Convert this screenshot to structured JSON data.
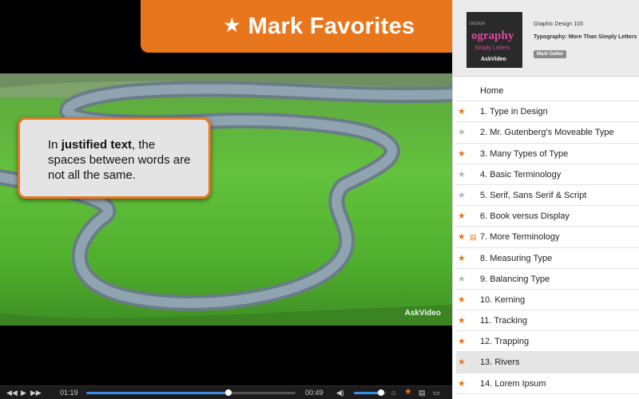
{
  "banner": {
    "star": "★",
    "title": "Mark Favorites"
  },
  "callout": {
    "prefix": "In ",
    "bold": "justified text",
    "rest": ", the spaces between words are not all the same."
  },
  "watermark": "AskVideo",
  "controls": {
    "elapsed": "01:19",
    "remaining": "00:49",
    "progress": 0.68,
    "volume": 0.85
  },
  "course": {
    "thumb_small": "DESIGN",
    "thumb_title": "ography",
    "thumb_sub": "Simply Letters",
    "thumb_brand": "AskVideo",
    "title": "Graphic Design 103",
    "subtitle": "Typography: More Than Simply Letters",
    "author": "Mark Gatter"
  },
  "chapters": [
    {
      "label": "Home",
      "star": "none",
      "doc": false,
      "selected": false
    },
    {
      "label": "1. Type in Design",
      "star": "on",
      "doc": false,
      "selected": false
    },
    {
      "label": "2. Mr. Gutenberg's Moveable Type",
      "star": "off",
      "doc": false,
      "selected": false
    },
    {
      "label": "3. Many Types of Type",
      "star": "on",
      "doc": false,
      "selected": false
    },
    {
      "label": "4. Basic Terminology",
      "star": "off",
      "doc": false,
      "selected": false
    },
    {
      "label": "5. Serif, Sans Serif & Script",
      "star": "off",
      "doc": false,
      "selected": false
    },
    {
      "label": "6. Book versus Display",
      "star": "on",
      "doc": false,
      "selected": false
    },
    {
      "label": "7. More Terminology",
      "star": "on",
      "doc": true,
      "selected": false
    },
    {
      "label": "8. Measuring Type",
      "star": "on",
      "doc": false,
      "selected": false
    },
    {
      "label": "9. Balancing Type",
      "star": "off",
      "doc": false,
      "selected": false
    },
    {
      "label": "10. Kerning",
      "star": "on",
      "doc": false,
      "selected": false
    },
    {
      "label": "11. Tracking",
      "star": "on",
      "doc": false,
      "selected": false
    },
    {
      "label": "12. Trapping",
      "star": "on",
      "doc": false,
      "selected": false
    },
    {
      "label": "13. Rivers",
      "star": "on",
      "doc": false,
      "selected": true
    },
    {
      "label": "14. Lorem Ipsum",
      "star": "on",
      "doc": false,
      "selected": false
    }
  ],
  "colors": {
    "accent": "#e8761c",
    "star_off": "#b5b5b5",
    "progress": "#3a8ee6"
  }
}
